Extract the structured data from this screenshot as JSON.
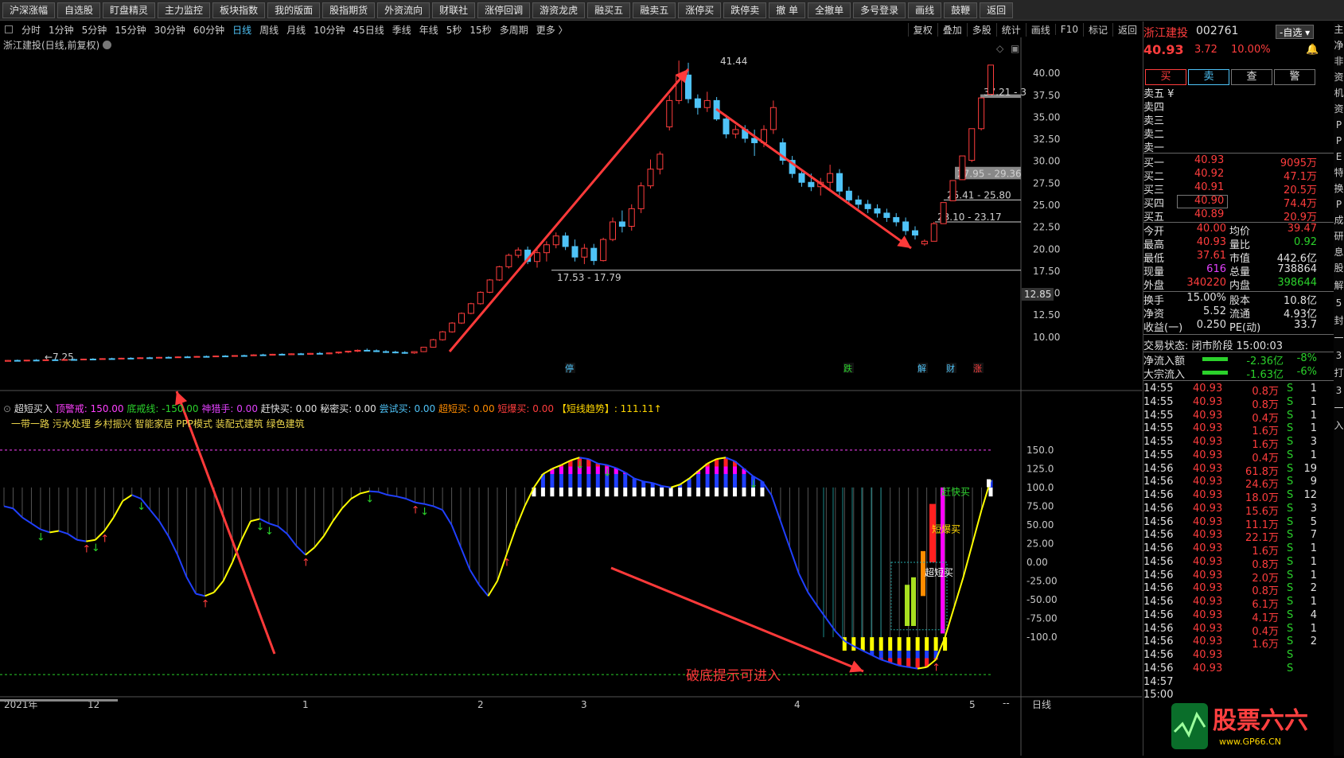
{
  "toolbar": [
    "沪深涨幅",
    "自选股",
    "盯盘精灵",
    "主力监控",
    "板块指数",
    "我的版面",
    "股指期货",
    "外资流向",
    "财联社",
    "涨停回调",
    "游资龙虎",
    "融买五",
    "融卖五",
    "涨停买",
    "跌停卖",
    "撤 单",
    "全撤单",
    "多号登录",
    "画线",
    "鼓鞭",
    "返回"
  ],
  "periods": [
    "分时",
    "1分钟",
    "5分钟",
    "15分钟",
    "30分钟",
    "60分钟",
    "日线",
    "周线",
    "月线",
    "10分钟",
    "45日线",
    "季线",
    "年线",
    "5秒",
    "15秒",
    "多周期",
    "更多 〉"
  ],
  "active_period": "日线",
  "right_tools": [
    "复权",
    "叠加",
    "多股",
    "统计",
    "画线",
    "F10",
    "标记",
    "返回"
  ],
  "stock_title": "浙江建投(日线,前复权)",
  "indicator": {
    "name": "超短买入",
    "params": [
      {
        "text": "顶警戒: 150.00",
        "color": "#ff40ff"
      },
      {
        "text": "底戒线: -150.00",
        "color": "#2bd12b"
      },
      {
        "text": "神猎手: 0.00",
        "color": "#e040fb"
      },
      {
        "text": "赶快买: 0.00",
        "color": "#e0e0e0"
      },
      {
        "text": "秘密买: 0.00",
        "color": "#e0e0e0"
      },
      {
        "text": "尝试买: 0.00",
        "color": "#4fc3f7"
      },
      {
        "text": "超短买: 0.00",
        "color": "#ff8c00"
      },
      {
        "text": "短爆买: 0.00",
        "color": "#ff3d3d"
      },
      {
        "text": "【短线趋势】: 111.11↑",
        "color": "#ffd700"
      }
    ],
    "sub": "一带一路 污水处理 乡村振兴 智能家居 PPP模式 装配式建筑 绿色建筑"
  },
  "price_axis": [
    "40.00",
    "37.50",
    "35.00",
    "32.50",
    "30.00",
    "27.50",
    "25.00",
    "22.50",
    "20.00",
    "17.50",
    "15.00",
    "12.50",
    "10.00"
  ],
  "price_current_tag": "12.85",
  "ind_axis": [
    "150.0",
    "125.0",
    "100.0",
    "75.00",
    "50.00",
    "25.00",
    "0.00",
    "-25.00",
    "-50.00",
    "-75.00",
    "-100.0"
  ],
  "date_axis": [
    "2021年",
    "12",
    "1",
    "2",
    "3",
    "4",
    "5"
  ],
  "date_axis_right": "日线",
  "annotations": {
    "low_label": "7.25",
    "high_label": "41.44",
    "zone1": "17.53 - 17.79",
    "zone2": "23.10 - 23.17",
    "zone3": "25.41 - 25.80",
    "zone4": "27.95 - 29.36",
    "zone5": "37.21 - 3",
    "bottom_hint": "破底提示可进入",
    "buy_fast": "赶快买",
    "buy_burst": "短爆买",
    "buy_short": "超短买"
  },
  "event_marks": [
    {
      "text": "停",
      "color": "#4fc3f7"
    },
    {
      "text": "跌",
      "color": "#2bd12b"
    },
    {
      "text": "解",
      "color": "#4fc3f7"
    },
    {
      "text": "财",
      "color": "#4fc3f7"
    },
    {
      "text": "涨",
      "color": "#ff3d3d"
    }
  ],
  "quote": {
    "name": "浙江建投",
    "code": "002761",
    "zixuan": "-自选",
    "price": "40.93",
    "change": "3.72",
    "pct": "10.00%",
    "buttons": [
      "买",
      "卖",
      "查",
      "警"
    ],
    "sell_levels": [
      "卖五 ¥",
      "卖四",
      "卖三",
      "卖二",
      "卖一"
    ],
    "buy_levels": [
      {
        "label": "买一",
        "price": "40.93",
        "vol": "9095万"
      },
      {
        "label": "买二",
        "price": "40.92",
        "vol": "47.1万"
      },
      {
        "label": "买三",
        "price": "40.91",
        "vol": "20.5万"
      },
      {
        "label": "买四",
        "price": "40.90",
        "vol": "74.4万"
      },
      {
        "label": "买五",
        "price": "40.89",
        "vol": "20.9万"
      }
    ],
    "stats": [
      {
        "l1": "今开",
        "v1": "40.00",
        "c1": "r",
        "l2": "均价",
        "v2": "39.47",
        "c2": "r"
      },
      {
        "l1": "最高",
        "v1": "40.93",
        "c1": "r",
        "l2": "量比",
        "v2": "0.92",
        "c2": "g"
      },
      {
        "l1": "最低",
        "v1": "37.61",
        "c1": "r",
        "l2": "市值",
        "v2": "442.6亿",
        "c2": "w"
      },
      {
        "l1": "现量",
        "v1": "616",
        "c1": "m",
        "l2": "总量",
        "v2": "738864",
        "c2": "w"
      },
      {
        "l1": "外盘",
        "v1": "340220",
        "c1": "r",
        "l2": "内盘",
        "v2": "398644",
        "c2": "g"
      }
    ],
    "stats2": [
      {
        "l1": "换手",
        "v1": "15.00%",
        "l2": "股本",
        "v2": "10.8亿"
      },
      {
        "l1": "净资",
        "v1": "5.52",
        "l2": "流通",
        "v2": "4.93亿"
      },
      {
        "l1": "收益(一)",
        "v1": "0.250",
        "l2": "PE(动)",
        "v2": "33.7"
      }
    ],
    "state": "交易状态: 闭市阶段 15:00:03",
    "flows": [
      {
        "label": "净流入额",
        "value": "-2.36亿",
        "pct": "-8%"
      },
      {
        "label": "大宗流入",
        "value": "-1.63亿",
        "pct": "-6%"
      }
    ],
    "ticks": [
      {
        "t": "14:55",
        "p": "40.93",
        "v": "0.8万",
        "s": "S",
        "n": "1"
      },
      {
        "t": "14:55",
        "p": "40.93",
        "v": "0.8万",
        "s": "S",
        "n": "1"
      },
      {
        "t": "14:55",
        "p": "40.93",
        "v": "0.4万",
        "s": "S",
        "n": "1"
      },
      {
        "t": "14:55",
        "p": "40.93",
        "v": "1.6万",
        "s": "S",
        "n": "1"
      },
      {
        "t": "14:55",
        "p": "40.93",
        "v": "1.6万",
        "s": "S",
        "n": "3"
      },
      {
        "t": "14:55",
        "p": "40.93",
        "v": "0.4万",
        "s": "S",
        "n": "1"
      },
      {
        "t": "14:56",
        "p": "40.93",
        "v": "61.8万",
        "s": "S",
        "n": "19"
      },
      {
        "t": "14:56",
        "p": "40.93",
        "v": "24.6万",
        "s": "S",
        "n": "9"
      },
      {
        "t": "14:56",
        "p": "40.93",
        "v": "18.0万",
        "s": "S",
        "n": "12"
      },
      {
        "t": "14:56",
        "p": "40.93",
        "v": "15.6万",
        "s": "S",
        "n": "3"
      },
      {
        "t": "14:56",
        "p": "40.93",
        "v": "11.1万",
        "s": "S",
        "n": "5"
      },
      {
        "t": "14:56",
        "p": "40.93",
        "v": "22.1万",
        "s": "S",
        "n": "7"
      },
      {
        "t": "14:56",
        "p": "40.93",
        "v": "1.6万",
        "s": "S",
        "n": "1"
      },
      {
        "t": "14:56",
        "p": "40.93",
        "v": "0.8万",
        "s": "S",
        "n": "1"
      },
      {
        "t": "14:56",
        "p": "40.93",
        "v": "2.0万",
        "s": "S",
        "n": "1"
      },
      {
        "t": "14:56",
        "p": "40.93",
        "v": "0.8万",
        "s": "S",
        "n": "2"
      },
      {
        "t": "14:56",
        "p": "40.93",
        "v": "6.1万",
        "s": "S",
        "n": "1"
      },
      {
        "t": "14:56",
        "p": "40.93",
        "v": "4.1万",
        "s": "S",
        "n": "4"
      },
      {
        "t": "14:56",
        "p": "40.93",
        "v": "0.4万",
        "s": "S",
        "n": "1"
      },
      {
        "t": "14:56",
        "p": "40.93",
        "v": "1.6万",
        "s": "S",
        "n": "2"
      },
      {
        "t": "14:56",
        "p": "40.93",
        "v": "",
        "s": "S",
        "n": ""
      },
      {
        "t": "14:56",
        "p": "40.93",
        "v": "",
        "s": "S",
        "n": ""
      },
      {
        "t": "14:57",
        "p": "",
        "v": "",
        "s": "",
        "n": ""
      },
      {
        "t": "15:00",
        "p": "",
        "v": "",
        "s": "",
        "n": ""
      }
    ],
    "edge_chars": "主净非资机资PPE特换P成研息股解",
    "edge_chars_bottom": "5封一3打3一入",
    "watermark": "股票六六",
    "watermark_url": "www.GP66.CN"
  },
  "colors": {
    "up": "#ff3d3d",
    "down": "#4fc3f7",
    "line_yellow": "#ffff00",
    "line_blue": "#2040ff"
  },
  "chart_data": {
    "type": "candlestick",
    "title": "浙江建投(日线,前复权)",
    "ylim": [
      7,
      42
    ],
    "candles": [
      {
        "o": 7.25,
        "h": 7.4,
        "l": 7.25,
        "c": 7.35
      },
      {
        "o": 7.35,
        "h": 7.45,
        "l": 7.3,
        "c": 7.3
      },
      {
        "o": 7.3,
        "h": 7.4,
        "l": 7.25,
        "c": 7.38
      },
      {
        "o": 7.38,
        "h": 7.5,
        "l": 7.3,
        "c": 7.35
      },
      {
        "o": 7.35,
        "h": 7.45,
        "l": 7.3,
        "c": 7.42
      },
      {
        "o": 7.42,
        "h": 7.5,
        "l": 7.35,
        "c": 7.38
      },
      {
        "o": 7.38,
        "h": 7.5,
        "l": 7.35,
        "c": 7.45
      },
      {
        "o": 7.45,
        "h": 7.55,
        "l": 7.4,
        "c": 7.42
      },
      {
        "o": 7.42,
        "h": 7.55,
        "l": 7.4,
        "c": 7.5
      },
      {
        "o": 7.5,
        "h": 7.6,
        "l": 7.45,
        "c": 7.48
      },
      {
        "o": 7.48,
        "h": 7.6,
        "l": 7.45,
        "c": 7.55
      },
      {
        "o": 7.55,
        "h": 7.65,
        "l": 7.5,
        "c": 7.52
      },
      {
        "o": 7.52,
        "h": 7.65,
        "l": 7.5,
        "c": 7.6
      },
      {
        "o": 7.6,
        "h": 7.7,
        "l": 7.55,
        "c": 7.58
      },
      {
        "o": 7.58,
        "h": 7.7,
        "l": 7.55,
        "c": 7.65
      },
      {
        "o": 7.65,
        "h": 7.75,
        "l": 7.6,
        "c": 7.62
      },
      {
        "o": 7.62,
        "h": 7.75,
        "l": 7.6,
        "c": 7.7
      },
      {
        "o": 7.7,
        "h": 7.8,
        "l": 7.65,
        "c": 7.68
      },
      {
        "o": 7.68,
        "h": 7.8,
        "l": 7.65,
        "c": 7.75
      },
      {
        "o": 7.75,
        "h": 7.85,
        "l": 7.7,
        "c": 7.72
      },
      {
        "o": 7.72,
        "h": 7.85,
        "l": 7.7,
        "c": 7.8
      },
      {
        "o": 7.8,
        "h": 7.9,
        "l": 7.75,
        "c": 7.78
      },
      {
        "o": 7.78,
        "h": 7.9,
        "l": 7.75,
        "c": 7.85
      },
      {
        "o": 7.85,
        "h": 7.95,
        "l": 7.8,
        "c": 7.82
      },
      {
        "o": 7.82,
        "h": 7.95,
        "l": 7.8,
        "c": 7.9
      },
      {
        "o": 7.9,
        "h": 8.0,
        "l": 7.85,
        "c": 7.88
      },
      {
        "o": 7.88,
        "h": 8.05,
        "l": 7.85,
        "c": 7.98
      },
      {
        "o": 7.98,
        "h": 8.1,
        "l": 7.9,
        "c": 7.95
      },
      {
        "o": 7.95,
        "h": 8.1,
        "l": 7.9,
        "c": 8.05
      },
      {
        "o": 8.05,
        "h": 8.15,
        "l": 7.95,
        "c": 8.0
      },
      {
        "o": 8.0,
        "h": 8.15,
        "l": 7.95,
        "c": 8.1
      },
      {
        "o": 8.1,
        "h": 8.2,
        "l": 8.0,
        "c": 8.05
      },
      {
        "o": 8.05,
        "h": 8.2,
        "l": 8.0,
        "c": 8.15
      },
      {
        "o": 8.15,
        "h": 8.3,
        "l": 8.1,
        "c": 8.1
      },
      {
        "o": 8.1,
        "h": 8.25,
        "l": 8.05,
        "c": 8.2
      },
      {
        "o": 8.2,
        "h": 8.35,
        "l": 8.1,
        "c": 8.3
      },
      {
        "o": 8.3,
        "h": 8.45,
        "l": 8.2,
        "c": 8.4
      },
      {
        "o": 8.4,
        "h": 8.6,
        "l": 8.3,
        "c": 8.5
      },
      {
        "o": 8.5,
        "h": 8.7,
        "l": 8.4,
        "c": 8.45
      },
      {
        "o": 8.45,
        "h": 8.6,
        "l": 8.3,
        "c": 8.35
      },
      {
        "o": 8.35,
        "h": 8.5,
        "l": 8.2,
        "c": 8.3
      },
      {
        "o": 8.3,
        "h": 8.45,
        "l": 8.15,
        "c": 8.25
      },
      {
        "o": 8.25,
        "h": 8.4,
        "l": 8.1,
        "c": 8.2
      },
      {
        "o": 8.2,
        "h": 8.4,
        "l": 8.1,
        "c": 8.35
      },
      {
        "o": 8.35,
        "h": 8.9,
        "l": 8.3,
        "c": 8.85
      },
      {
        "o": 8.85,
        "h": 9.8,
        "l": 8.8,
        "c": 9.7
      },
      {
        "o": 9.7,
        "h": 10.7,
        "l": 9.6,
        "c": 10.6
      },
      {
        "o": 10.6,
        "h": 11.7,
        "l": 10.5,
        "c": 11.6
      },
      {
        "o": 11.6,
        "h": 12.8,
        "l": 11.5,
        "c": 12.7
      },
      {
        "o": 12.7,
        "h": 13.9,
        "l": 12.6,
        "c": 13.8
      },
      {
        "o": 13.8,
        "h": 15.2,
        "l": 13.7,
        "c": 15.1
      },
      {
        "o": 15.1,
        "h": 16.6,
        "l": 15.0,
        "c": 16.5
      },
      {
        "o": 16.5,
        "h": 18.1,
        "l": 16.4,
        "c": 18.0
      },
      {
        "o": 18.0,
        "h": 19.5,
        "l": 17.8,
        "c": 19.3
      },
      {
        "o": 19.3,
        "h": 20.2,
        "l": 19.0,
        "c": 19.9
      },
      {
        "o": 19.9,
        "h": 20.3,
        "l": 18.3,
        "c": 18.6
      },
      {
        "o": 18.6,
        "h": 20.0,
        "l": 17.9,
        "c": 19.6
      },
      {
        "o": 19.6,
        "h": 20.9,
        "l": 18.6,
        "c": 20.5
      },
      {
        "o": 20.5,
        "h": 21.9,
        "l": 20.1,
        "c": 21.5
      },
      {
        "o": 21.5,
        "h": 21.9,
        "l": 19.9,
        "c": 20.3
      },
      {
        "o": 20.3,
        "h": 21.1,
        "l": 18.6,
        "c": 19.1
      },
      {
        "o": 19.1,
        "h": 20.6,
        "l": 18.3,
        "c": 20.1
      },
      {
        "o": 20.1,
        "h": 20.6,
        "l": 18.2,
        "c": 18.7
      },
      {
        "o": 18.7,
        "h": 21.3,
        "l": 18.6,
        "c": 21.1
      },
      {
        "o": 21.1,
        "h": 23.6,
        "l": 20.9,
        "c": 23.1
      },
      {
        "o": 23.1,
        "h": 24.4,
        "l": 21.9,
        "c": 22.6
      },
      {
        "o": 22.6,
        "h": 25.1,
        "l": 22.1,
        "c": 24.6
      },
      {
        "o": 24.6,
        "h": 27.6,
        "l": 24.1,
        "c": 27.2
      },
      {
        "o": 27.2,
        "h": 30.2,
        "l": 26.9,
        "c": 29.1
      },
      {
        "o": 29.1,
        "h": 31.1,
        "l": 28.5,
        "c": 30.8
      },
      {
        "o": 33.9,
        "h": 37.5,
        "l": 33.5,
        "c": 36.9
      },
      {
        "o": 36.9,
        "h": 41.44,
        "l": 36.5,
        "c": 39.8
      },
      {
        "o": 39.8,
        "h": 41.2,
        "l": 36.6,
        "c": 37.1
      },
      {
        "o": 37.1,
        "h": 37.6,
        "l": 35.3,
        "c": 36.1
      },
      {
        "o": 36.1,
        "h": 37.9,
        "l": 35.6,
        "c": 36.9
      },
      {
        "o": 36.9,
        "h": 37.3,
        "l": 34.6,
        "c": 34.8
      },
      {
        "o": 34.8,
        "h": 35.3,
        "l": 32.6,
        "c": 33.1
      },
      {
        "o": 33.1,
        "h": 34.1,
        "l": 32.6,
        "c": 33.6
      },
      {
        "o": 33.6,
        "h": 34.1,
        "l": 32.1,
        "c": 32.6
      },
      {
        "o": 32.6,
        "h": 33.6,
        "l": 30.6,
        "c": 32.1
      },
      {
        "o": 32.1,
        "h": 34.1,
        "l": 31.6,
        "c": 33.6
      },
      {
        "o": 33.6,
        "h": 36.9,
        "l": 33.1,
        "c": 36.1
      },
      {
        "o": 32.1,
        "h": 32.6,
        "l": 29.6,
        "c": 30.1
      },
      {
        "o": 30.1,
        "h": 30.6,
        "l": 28.1,
        "c": 28.6
      },
      {
        "o": 28.6,
        "h": 29.1,
        "l": 27.1,
        "c": 27.6
      },
      {
        "o": 27.6,
        "h": 28.6,
        "l": 26.6,
        "c": 27.1
      },
      {
        "o": 27.1,
        "h": 28.1,
        "l": 26.1,
        "c": 27.6
      },
      {
        "o": 27.6,
        "h": 29.6,
        "l": 26.6,
        "c": 28.6
      },
      {
        "o": 28.6,
        "h": 29.1,
        "l": 26.1,
        "c": 26.6
      },
      {
        "o": 26.6,
        "h": 27.1,
        "l": 25.1,
        "c": 25.6
      },
      {
        "o": 25.6,
        "h": 26.1,
        "l": 24.6,
        "c": 25.1
      },
      {
        "o": 25.1,
        "h": 25.6,
        "l": 24.1,
        "c": 24.6
      },
      {
        "o": 24.6,
        "h": 25.1,
        "l": 23.6,
        "c": 24.1
      },
      {
        "o": 24.1,
        "h": 24.6,
        "l": 23.1,
        "c": 23.6
      },
      {
        "o": 23.6,
        "h": 24.1,
        "l": 22.6,
        "c": 23.1
      },
      {
        "o": 23.1,
        "h": 23.6,
        "l": 21.6,
        "c": 22.1
      },
      {
        "o": 22.1,
        "h": 22.6,
        "l": 21.1,
        "c": 21.6
      },
      {
        "o": 20.6,
        "h": 21.1,
        "l": 20.4,
        "c": 20.9
      },
      {
        "o": 20.9,
        "h": 23.1,
        "l": 20.9,
        "c": 22.9
      },
      {
        "o": 22.9,
        "h": 25.3,
        "l": 22.9,
        "c": 25.3
      },
      {
        "o": 25.5,
        "h": 27.8,
        "l": 25.5,
        "c": 27.8
      },
      {
        "o": 27.9,
        "h": 30.6,
        "l": 27.9,
        "c": 30.6
      },
      {
        "o": 30.1,
        "h": 33.7,
        "l": 29.9,
        "c": 33.7
      },
      {
        "o": 33.7,
        "h": 37.2,
        "l": 33.5,
        "c": 37.2
      },
      {
        "o": 37.6,
        "h": 40.93,
        "l": 37.61,
        "c": 40.93
      }
    ],
    "indicator_ylim": [
      -170,
      170
    ],
    "indicator_line": [
      75,
      72,
      60,
      52,
      44,
      40,
      42,
      38,
      30,
      28,
      30,
      42,
      60,
      82,
      90,
      85,
      70,
      55,
      35,
      10,
      -20,
      -42,
      -45,
      -40,
      -25,
      0,
      30,
      55,
      58,
      52,
      48,
      38,
      22,
      10,
      20,
      35,
      55,
      72,
      85,
      92,
      95,
      94,
      90,
      88,
      85,
      80,
      78,
      75,
      70,
      50,
      20,
      -10,
      -30,
      -45,
      -25,
      10,
      45,
      75,
      100,
      118,
      125,
      130,
      136,
      140,
      138,
      132,
      130,
      126,
      120,
      112,
      108,
      106,
      102,
      100,
      104,
      112,
      122,
      132,
      138,
      140,
      135,
      125,
      115,
      108,
      90,
      55,
      20,
      -15,
      -40,
      -58,
      -75,
      -92,
      -105,
      -112,
      -118,
      -124,
      -130,
      -134,
      -138,
      -140,
      -142,
      -140,
      -130,
      -100,
      -60,
      -20,
      25,
      70,
      110
    ]
  }
}
